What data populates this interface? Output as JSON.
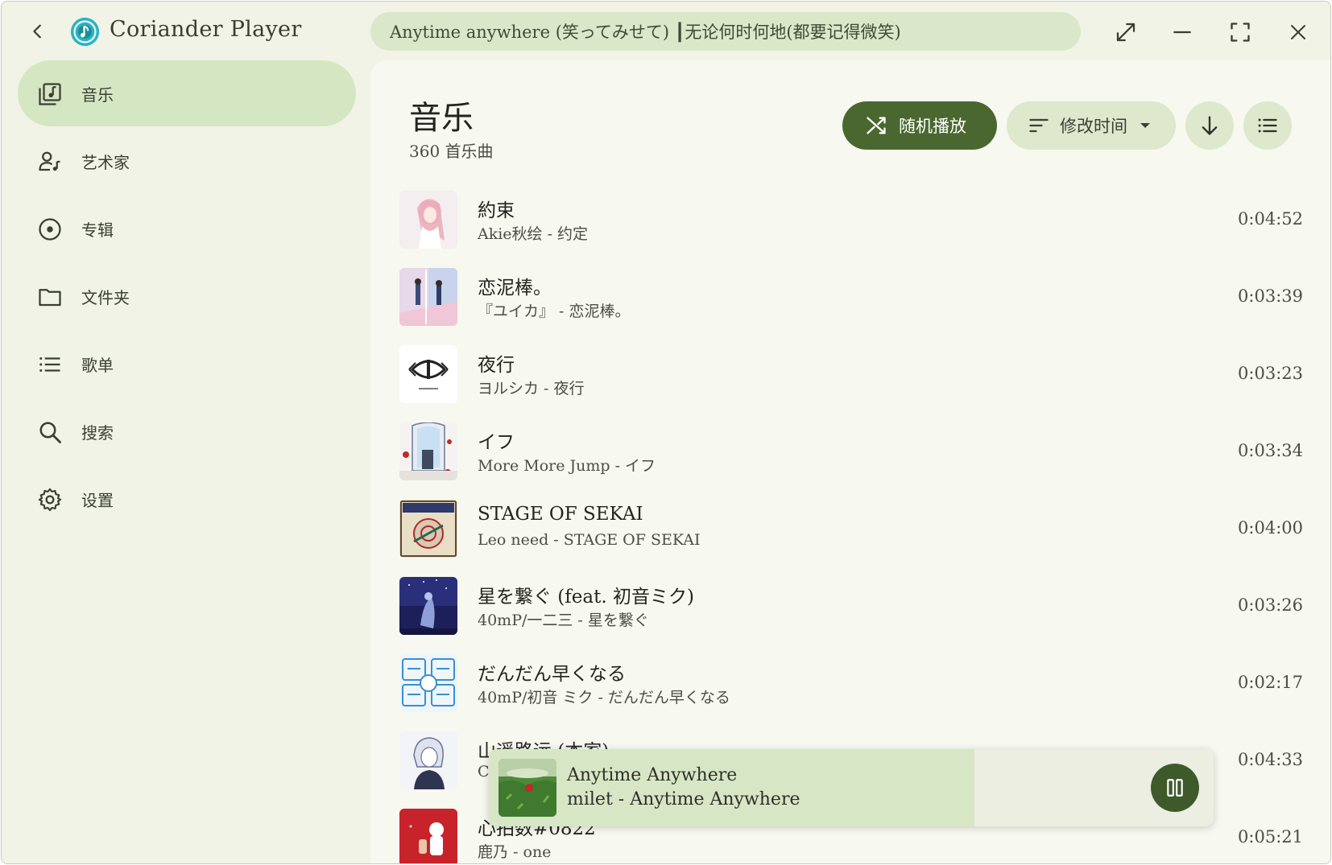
{
  "app": {
    "title": "Coriander Player",
    "now_playing_title": "Anytime anywhere (笑ってみせて) ┃无论何时何地(都要记得微笑)"
  },
  "sidebar": {
    "items": [
      {
        "label": "音乐",
        "icon": "music-library-icon",
        "active": true
      },
      {
        "label": "艺术家",
        "icon": "artist-icon",
        "active": false
      },
      {
        "label": "专辑",
        "icon": "album-icon",
        "active": false
      },
      {
        "label": "文件夹",
        "icon": "folder-icon",
        "active": false
      },
      {
        "label": "歌单",
        "icon": "playlist-icon",
        "active": false
      },
      {
        "label": "搜索",
        "icon": "search-icon",
        "active": false
      },
      {
        "label": "设置",
        "icon": "settings-icon",
        "active": false
      }
    ]
  },
  "main": {
    "title": "音乐",
    "subtitle": "360 首乐曲",
    "shuffle_label": "随机播放",
    "sort_label": "修改时间",
    "tracks": [
      {
        "title": "約束",
        "subtitle": "Akie秋绘 - 约定",
        "duration": "0:04:52"
      },
      {
        "title": "恋泥棒。",
        "subtitle": "『ユイカ』 - 恋泥棒。",
        "duration": "0:03:39"
      },
      {
        "title": "夜行",
        "subtitle": "ヨルシカ - 夜行",
        "duration": "0:03:23"
      },
      {
        "title": "イフ",
        "subtitle": "More More Jump - イフ",
        "duration": "0:03:34"
      },
      {
        "title": "STAGE OF SEKAI",
        "subtitle": "Leo need - STAGE OF SEKAI",
        "duration": "0:04:00"
      },
      {
        "title": "星を繋ぐ (feat. 初音ミク)",
        "subtitle": "40mP/一二三 - 星を繋ぐ",
        "duration": "0:03:26"
      },
      {
        "title": "だんだん早くなる",
        "subtitle": "40mP/初音 ミク - だんだん早くなる",
        "duration": "0:02:17"
      },
      {
        "title": "山遥路远 (本家)",
        "subtitle": "C",
        "duration": "0:04:33"
      },
      {
        "title": "心拍数#0822",
        "subtitle": "鹿乃 - one",
        "duration": "0:05:21"
      }
    ]
  },
  "player": {
    "title": "Anytime Anywhere",
    "subtitle": "milet - Anytime Anywhere",
    "progress": 0.67
  },
  "colors": {
    "accent": "#4a6730",
    "pill": "#dde8cd",
    "nav_active": "#d5e6c2"
  }
}
